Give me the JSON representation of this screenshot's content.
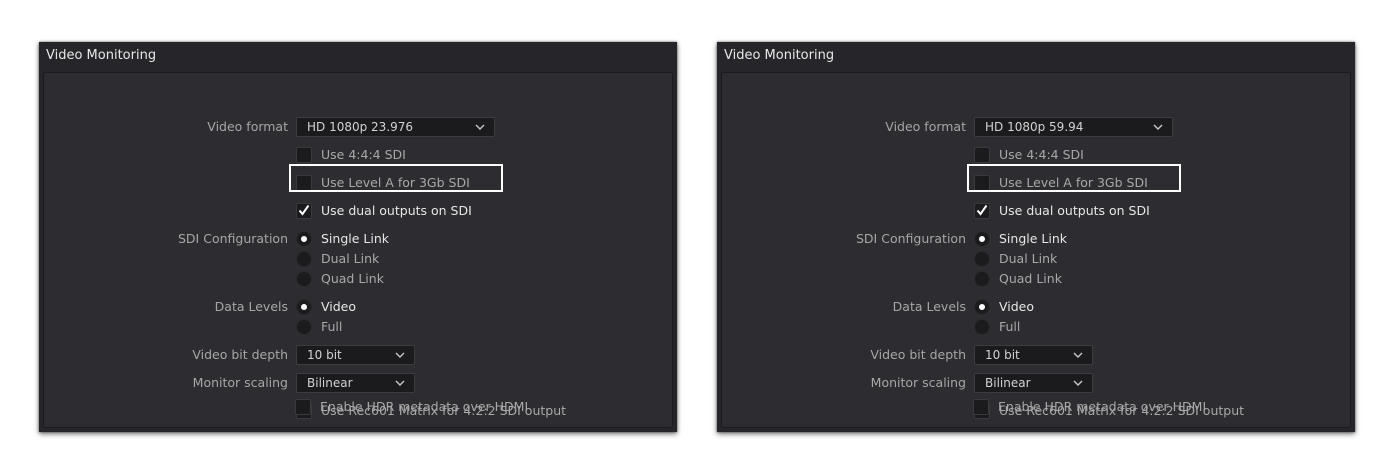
{
  "colors": {
    "panel_bg": "#26262a",
    "inner_bg": "#2d2d31",
    "highlight": "#ffffff",
    "label": "#a6a6a6"
  },
  "panels": [
    {
      "title": "Video Monitoring",
      "video_format_label": "Video format",
      "video_format_value": "HD 1080p 23.976",
      "use_444_sdi": "Use 4:4:4 SDI",
      "use_level_a": "Use Level A for 3Gb SDI",
      "use_dual_outputs": "Use dual outputs on SDI",
      "use_dual_outputs_checked": true,
      "sdi_config_label": "SDI Configuration",
      "sdi_options": [
        "Single Link",
        "Dual Link",
        "Quad Link"
      ],
      "sdi_selected": "Single Link",
      "data_levels_label": "Data Levels",
      "data_levels_options": [
        "Video",
        "Full"
      ],
      "data_levels_selected": "Video",
      "bit_depth_label": "Video bit depth",
      "bit_depth_value": "10 bit",
      "monitor_scaling_label": "Monitor scaling",
      "monitor_scaling_value": "Bilinear",
      "use_rec601": "Use Rec601 Matrix for 4:2:2 SDI output",
      "enable_hdr": "Enable HDR metadata over HDMI"
    },
    {
      "title": "Video Monitoring",
      "video_format_label": "Video format",
      "video_format_value": "HD 1080p 59.94",
      "use_444_sdi": "Use 4:4:4 SDI",
      "use_level_a": "Use Level A for 3Gb SDI",
      "use_dual_outputs": "Use dual outputs on SDI",
      "use_dual_outputs_checked": true,
      "sdi_config_label": "SDI Configuration",
      "sdi_options": [
        "Single Link",
        "Dual Link",
        "Quad Link"
      ],
      "sdi_selected": "Single Link",
      "data_levels_label": "Data Levels",
      "data_levels_options": [
        "Video",
        "Full"
      ],
      "data_levels_selected": "Video",
      "bit_depth_label": "Video bit depth",
      "bit_depth_value": "10 bit",
      "monitor_scaling_label": "Monitor scaling",
      "monitor_scaling_value": "Bilinear",
      "use_rec601": "Use Rec601 Matrix for 4:2:2 SDI output",
      "enable_hdr": "Enable HDR metadata over HDMI"
    }
  ]
}
